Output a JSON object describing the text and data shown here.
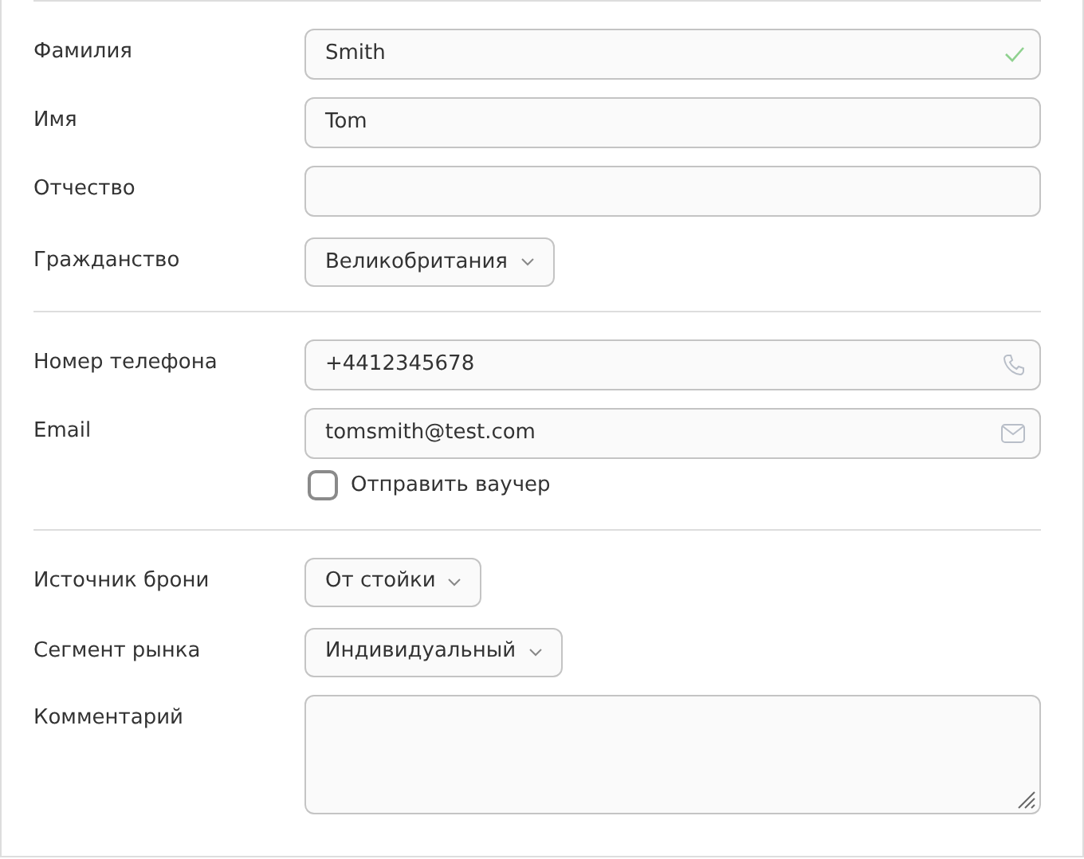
{
  "sections": [
    {
      "rows": [
        {
          "kind": "text",
          "label": "Фамилия",
          "value": "Smith",
          "valid": true
        },
        {
          "kind": "text",
          "label": "Имя",
          "value": "Tom",
          "valid": false
        },
        {
          "kind": "text",
          "label": "Отчество",
          "valid": false
        },
        {
          "kind": "select",
          "label": "Гражданство",
          "value": "Великобритания"
        }
      ]
    },
    {
      "rows": [
        {
          "kind": "phone",
          "label": "Номер телефона",
          "value": "+4412345678"
        },
        {
          "kind": "email",
          "label": "Email",
          "value": "tomsmith@test.com"
        },
        {
          "kind": "checkbox",
          "label": "Отправить ваучер",
          "checked": false
        }
      ]
    },
    {
      "rows": [
        {
          "kind": "select",
          "label": "Источник брони",
          "value": "От стойки"
        },
        {
          "kind": "select",
          "label": "Сегмент рынка",
          "value": "Индивидуальный"
        },
        {
          "kind": "textarea",
          "label": "Комментарий"
        }
      ]
    }
  ]
}
